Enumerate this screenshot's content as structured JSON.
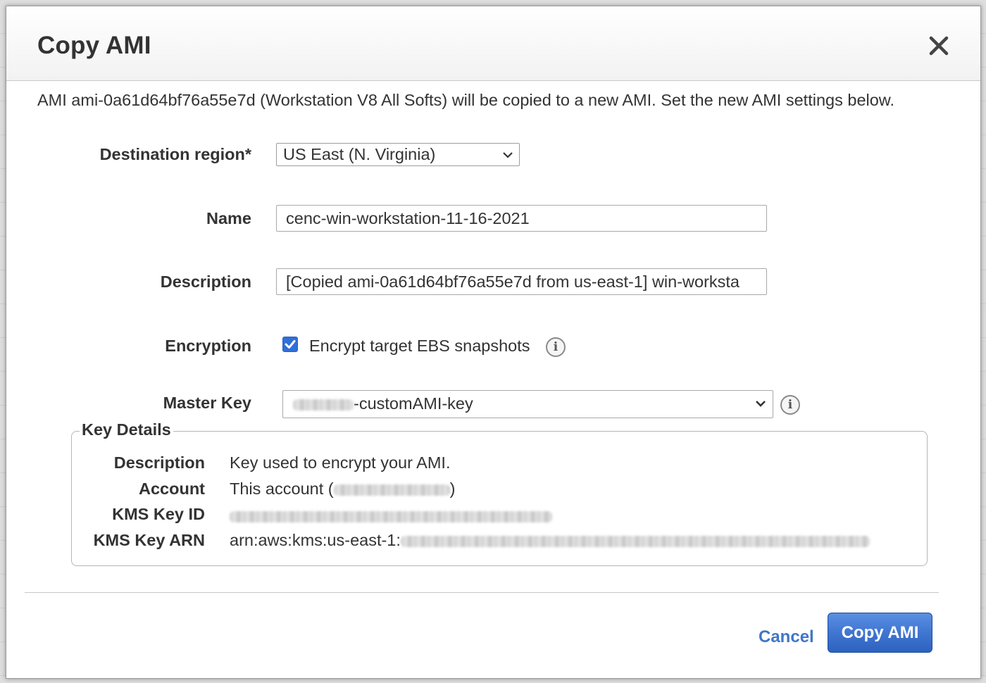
{
  "dialog": {
    "title": "Copy AMI",
    "intro": "AMI ami-0a61d64bf76a55e7d (Workstation V8 All Softs) will be copied to a new AMI. Set the new AMI settings below."
  },
  "form": {
    "destination_region": {
      "label": "Destination region*",
      "selected": "US East (N. Virginia)"
    },
    "name": {
      "label": "Name",
      "value": "cenc-win-workstation-11-16-2021"
    },
    "description": {
      "label": "Description",
      "value": "[Copied ami-0a61d64bf76a55e7d from us-east-1] win-worksta"
    },
    "encryption": {
      "label": "Encryption",
      "checked": true,
      "checkbox_label": "Encrypt target EBS snapshots"
    },
    "master_key": {
      "label": "Master Key",
      "selected_suffix": "-customAMI-key"
    }
  },
  "key_details": {
    "legend": "Key Details",
    "rows": [
      {
        "label": "Description",
        "value": "Key used to encrypt your AMI."
      },
      {
        "label": "Account",
        "value_prefix": "This account (",
        "value_suffix": ")"
      },
      {
        "label": "KMS Key ID"
      },
      {
        "label": "KMS Key ARN",
        "value_prefix": "arn:aws:kms:us-east-1:"
      }
    ]
  },
  "footer": {
    "cancel_label": "Cancel",
    "submit_label": "Copy AMI"
  },
  "colors": {
    "link": "#3f77c7",
    "primary_button": "#3e73cf",
    "checkbox": "#2f6fd8"
  },
  "icons": {
    "close": "close-icon",
    "info": "info-icon",
    "chevron": "chevron-down-icon",
    "check": "checkmark-icon"
  }
}
